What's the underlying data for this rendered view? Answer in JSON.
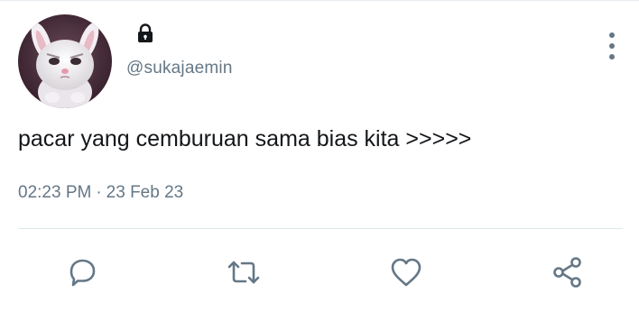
{
  "tweet": {
    "username": "@sukajaemin",
    "text": "pacar yang cemburuan sama bias kita >>>>>",
    "time": "02:23 PM",
    "separator": "·",
    "date": "23 Feb 23"
  },
  "icons": {
    "lock": "lock-icon",
    "more": "more-vertical-icon",
    "reply": "reply-icon",
    "retweet": "retweet-icon",
    "like": "heart-icon",
    "share": "share-icon"
  },
  "colors": {
    "primary_text": "#14171a",
    "secondary_text": "#657786",
    "divider": "#e1e8ed",
    "icon": "#657786"
  }
}
